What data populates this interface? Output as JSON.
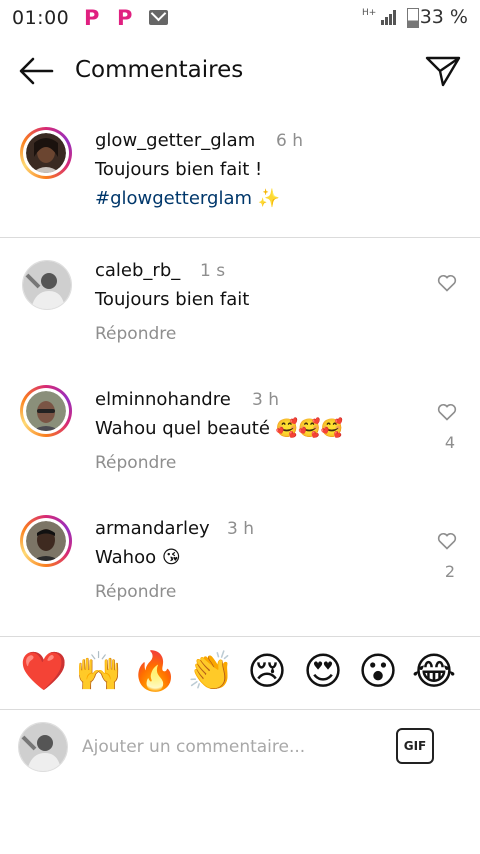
{
  "status_bar": {
    "time": "01:00",
    "battery": "33 %"
  },
  "header": {
    "title": "Commentaires"
  },
  "caption": {
    "username": "glow_getter_glam",
    "time": "6 h",
    "text": "Toujours bien fait !",
    "hashtag": "#glowgetterglam ✨"
  },
  "comments": [
    {
      "username": "caleb_rb_",
      "time": "1 s",
      "text": "Toujours bien fait",
      "reply_label": "Répondre",
      "likes": ""
    },
    {
      "username": "elminnohandre",
      "time": "3 h",
      "text": "Wahou quel beauté 🥰🥰🥰",
      "reply_label": "Répondre",
      "likes": "4"
    },
    {
      "username": "armandarley",
      "time": "3 h",
      "text": "Wahoo 😘",
      "reply_label": "Répondre",
      "likes": "2"
    }
  ],
  "emoji_bar": [
    "❤️",
    "🙌",
    "🔥",
    "👏",
    "😢",
    "😍",
    "😮",
    "😂"
  ],
  "comment_input": {
    "placeholder": "Ajouter un commentaire...",
    "value": ""
  },
  "gif_label": "GIF",
  "icons": {
    "back": "arrow-left-icon",
    "send": "paper-plane-icon",
    "like": "heart-outline-icon"
  },
  "colors": {
    "hashtag": "#00376b",
    "secondary_text": "#8e8e8e",
    "divider": "#dbdbdb"
  }
}
